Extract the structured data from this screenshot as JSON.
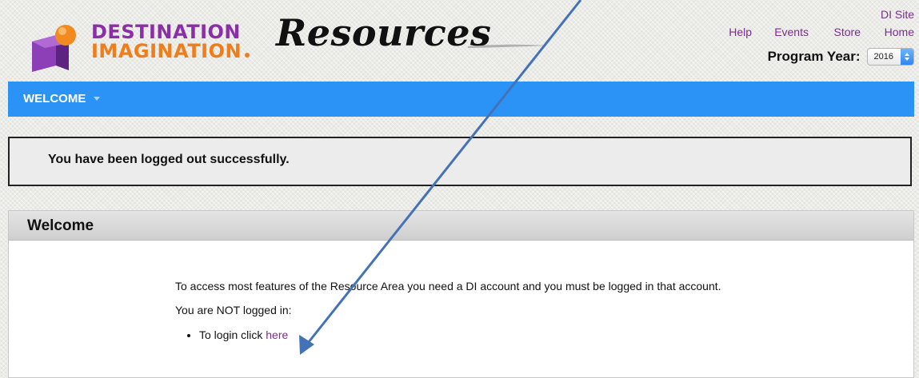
{
  "header": {
    "logo_line1": "DESTINATION",
    "logo_line2": "IMAGINATION",
    "site_title": "Resources",
    "links": {
      "help": "Help",
      "events": "Events",
      "store": "Store",
      "di_site": "DI Site",
      "home": "Home"
    },
    "program_year": {
      "label": "Program Year:",
      "selected": "2016"
    }
  },
  "nav": {
    "welcome_label": "WELCOME"
  },
  "alert": {
    "message": "You have been logged out successfully."
  },
  "panel": {
    "title": "Welcome",
    "intro": "To access most features of the Resource Area you need a DI account and you must be logged in that account.",
    "status": "You are NOT logged in:",
    "login_prefix": "To login click",
    "login_link": "here"
  },
  "colors": {
    "nav_blue": "#2b93f5",
    "link_purple": "#7b2d8e",
    "logo_purple": "#8b2fa8",
    "logo_orange": "#ef7d1a",
    "annotation_arrow": "#4472b8"
  }
}
